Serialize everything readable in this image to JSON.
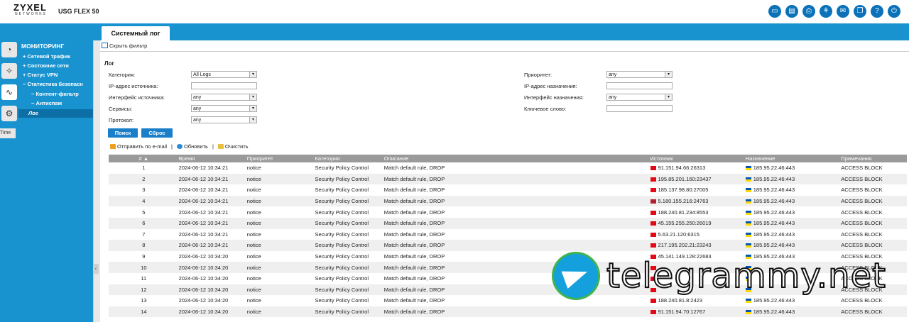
{
  "app": {
    "brand": "ZYXEL",
    "brand_sub": "NETWORKS",
    "model": "USG FLEX 50"
  },
  "header_icons": [
    "monitor-icon",
    "window-icon",
    "print-icon",
    "network-icon",
    "chat-icon",
    "book-icon",
    "help-icon",
    "power-icon"
  ],
  "tab": {
    "label": "Системный лог"
  },
  "rail": {
    "tooltip": "Time"
  },
  "sidebar": {
    "title": "МОНИТОРИНГ",
    "items": [
      {
        "label": "+ Сетевой трафик"
      },
      {
        "label": "+ Состояние сети"
      },
      {
        "label": "+ Статус VPN"
      },
      {
        "label": "− Статистика безопасн"
      },
      {
        "label": "− Контент-фильтр"
      },
      {
        "label": "− Антиспам"
      },
      {
        "label": "Лог"
      }
    ]
  },
  "filter": {
    "toggle_label": "Скрыть фильтр",
    "section": "Лог",
    "left": [
      {
        "label": "Категория:",
        "value": "All Logs",
        "select": true
      },
      {
        "label": "IP-адрес источника:",
        "value": "",
        "select": false
      },
      {
        "label": "Интерфейс источника:",
        "value": "any",
        "select": true
      },
      {
        "label": "Сервисы:",
        "value": "any",
        "select": true
      },
      {
        "label": "Протокол:",
        "value": "any",
        "select": true
      }
    ],
    "right": [
      {
        "label": "Приоритет:",
        "value": "any",
        "select": true
      },
      {
        "label": "IP-адрес назначения:",
        "value": "",
        "select": false
      },
      {
        "label": "Интерфейс назначения:",
        "value": "any",
        "select": true
      },
      {
        "label": "Ключевое слово:",
        "value": "",
        "select": false
      }
    ],
    "search_btn": "Поиск",
    "reset_btn": "Сброс"
  },
  "toolbar": {
    "email": "Отправить по e-mail",
    "refresh": "Обновить",
    "clear": "Очистить"
  },
  "table": {
    "columns": [
      "# ▲",
      "Время",
      "Приоритет",
      "Категория",
      "Описание",
      "Источник",
      "Назначение",
      "Примечания"
    ],
    "rows": [
      [
        "1",
        "2024-06-12 10:34:21",
        "notice",
        "Security Policy Control",
        "Match default rule, DROP",
        "91.151.94.66:26313",
        "185.95.22.46:443",
        "ACCESS BLOCK"
      ],
      [
        "2",
        "2024-06-12 10:34:21",
        "notice",
        "Security Policy Control",
        "Match default rule, DROP",
        "195.85.201.160:23437",
        "185.95.22.46:443",
        "ACCESS BLOCK"
      ],
      [
        "3",
        "2024-06-12 10:34:21",
        "notice",
        "Security Policy Control",
        "Match default rule, DROP",
        "185.137.98.80:27005",
        "185.95.22.46:443",
        "ACCESS BLOCK"
      ],
      [
        "4",
        "2024-06-12 10:34:21",
        "notice",
        "Security Policy Control",
        "Match default rule, DROP",
        "5.180.155.216:24763",
        "185.95.22.46:443",
        "ACCESS BLOCK"
      ],
      [
        "5",
        "2024-06-12 10:34:21",
        "notice",
        "Security Policy Control",
        "Match default rule, DROP",
        "188.240.81.234:8553",
        "185.95.22.46:443",
        "ACCESS BLOCK"
      ],
      [
        "6",
        "2024-06-12 10:34:21",
        "notice",
        "Security Policy Control",
        "Match default rule, DROP",
        "45.155.255.250:26019",
        "185.95.22.46:443",
        "ACCESS BLOCK"
      ],
      [
        "7",
        "2024-06-12 10:34:21",
        "notice",
        "Security Policy Control",
        "Match default rule, DROP",
        "5.63.21.120:6315",
        "185.95.22.46:443",
        "ACCESS BLOCK"
      ],
      [
        "8",
        "2024-06-12 10:34:21",
        "notice",
        "Security Policy Control",
        "Match default rule, DROP",
        "217.195.202.21:23243",
        "185.95.22.46:443",
        "ACCESS BLOCK"
      ],
      [
        "9",
        "2024-06-12 10:34:20",
        "notice",
        "Security Policy Control",
        "Match default rule, DROP",
        "45.141.149.128:22683",
        "185.95.22.46:443",
        "ACCESS BLOCK"
      ],
      [
        "10",
        "2024-06-12 10:34:20",
        "notice",
        "Security Policy Control",
        "Match default rule, DROP",
        "",
        "",
        "ACCESS BLOCK"
      ],
      [
        "11",
        "2024-06-12 10:34:20",
        "notice",
        "Security Policy Control",
        "Match default rule, DROP",
        "",
        "",
        "ACCESS BLOCK"
      ],
      [
        "12",
        "2024-06-12 10:34:20",
        "notice",
        "Security Policy Control",
        "Match default rule, DROP",
        "",
        "",
        "ACCESS BLOCK"
      ],
      [
        "13",
        "2024-06-12 10:34:20",
        "notice",
        "Security Policy Control",
        "Match default rule, DROP",
        "188.240.81.8:2423",
        "185.95.22.46:443",
        "ACCESS BLOCK"
      ],
      [
        "14",
        "2024-06-12 10:34:20",
        "notice",
        "Security Policy Control",
        "Match default rule, DROP",
        "91.151.94.70:12767",
        "185.95.22.46:443",
        "ACCESS BLOCK"
      ]
    ]
  },
  "source_flag_colors": [
    "#e30a17",
    "#e30a17",
    "#e30a17",
    "#b22234",
    "#e30a17",
    "#e30a17",
    "#e30a17",
    "#e30a17",
    "#e30a17",
    "#e30a17",
    "#e30a17",
    "#e30a17",
    "#e30a17",
    "#e30a17"
  ],
  "dest_flag_colors": [
    "#0057b7",
    "#ffd700"
  ],
  "watermark": "telegrammy.net",
  "colors": {
    "accent": "#1993d0",
    "button": "#1a7fc8",
    "header_row": "#9a9a9a"
  }
}
